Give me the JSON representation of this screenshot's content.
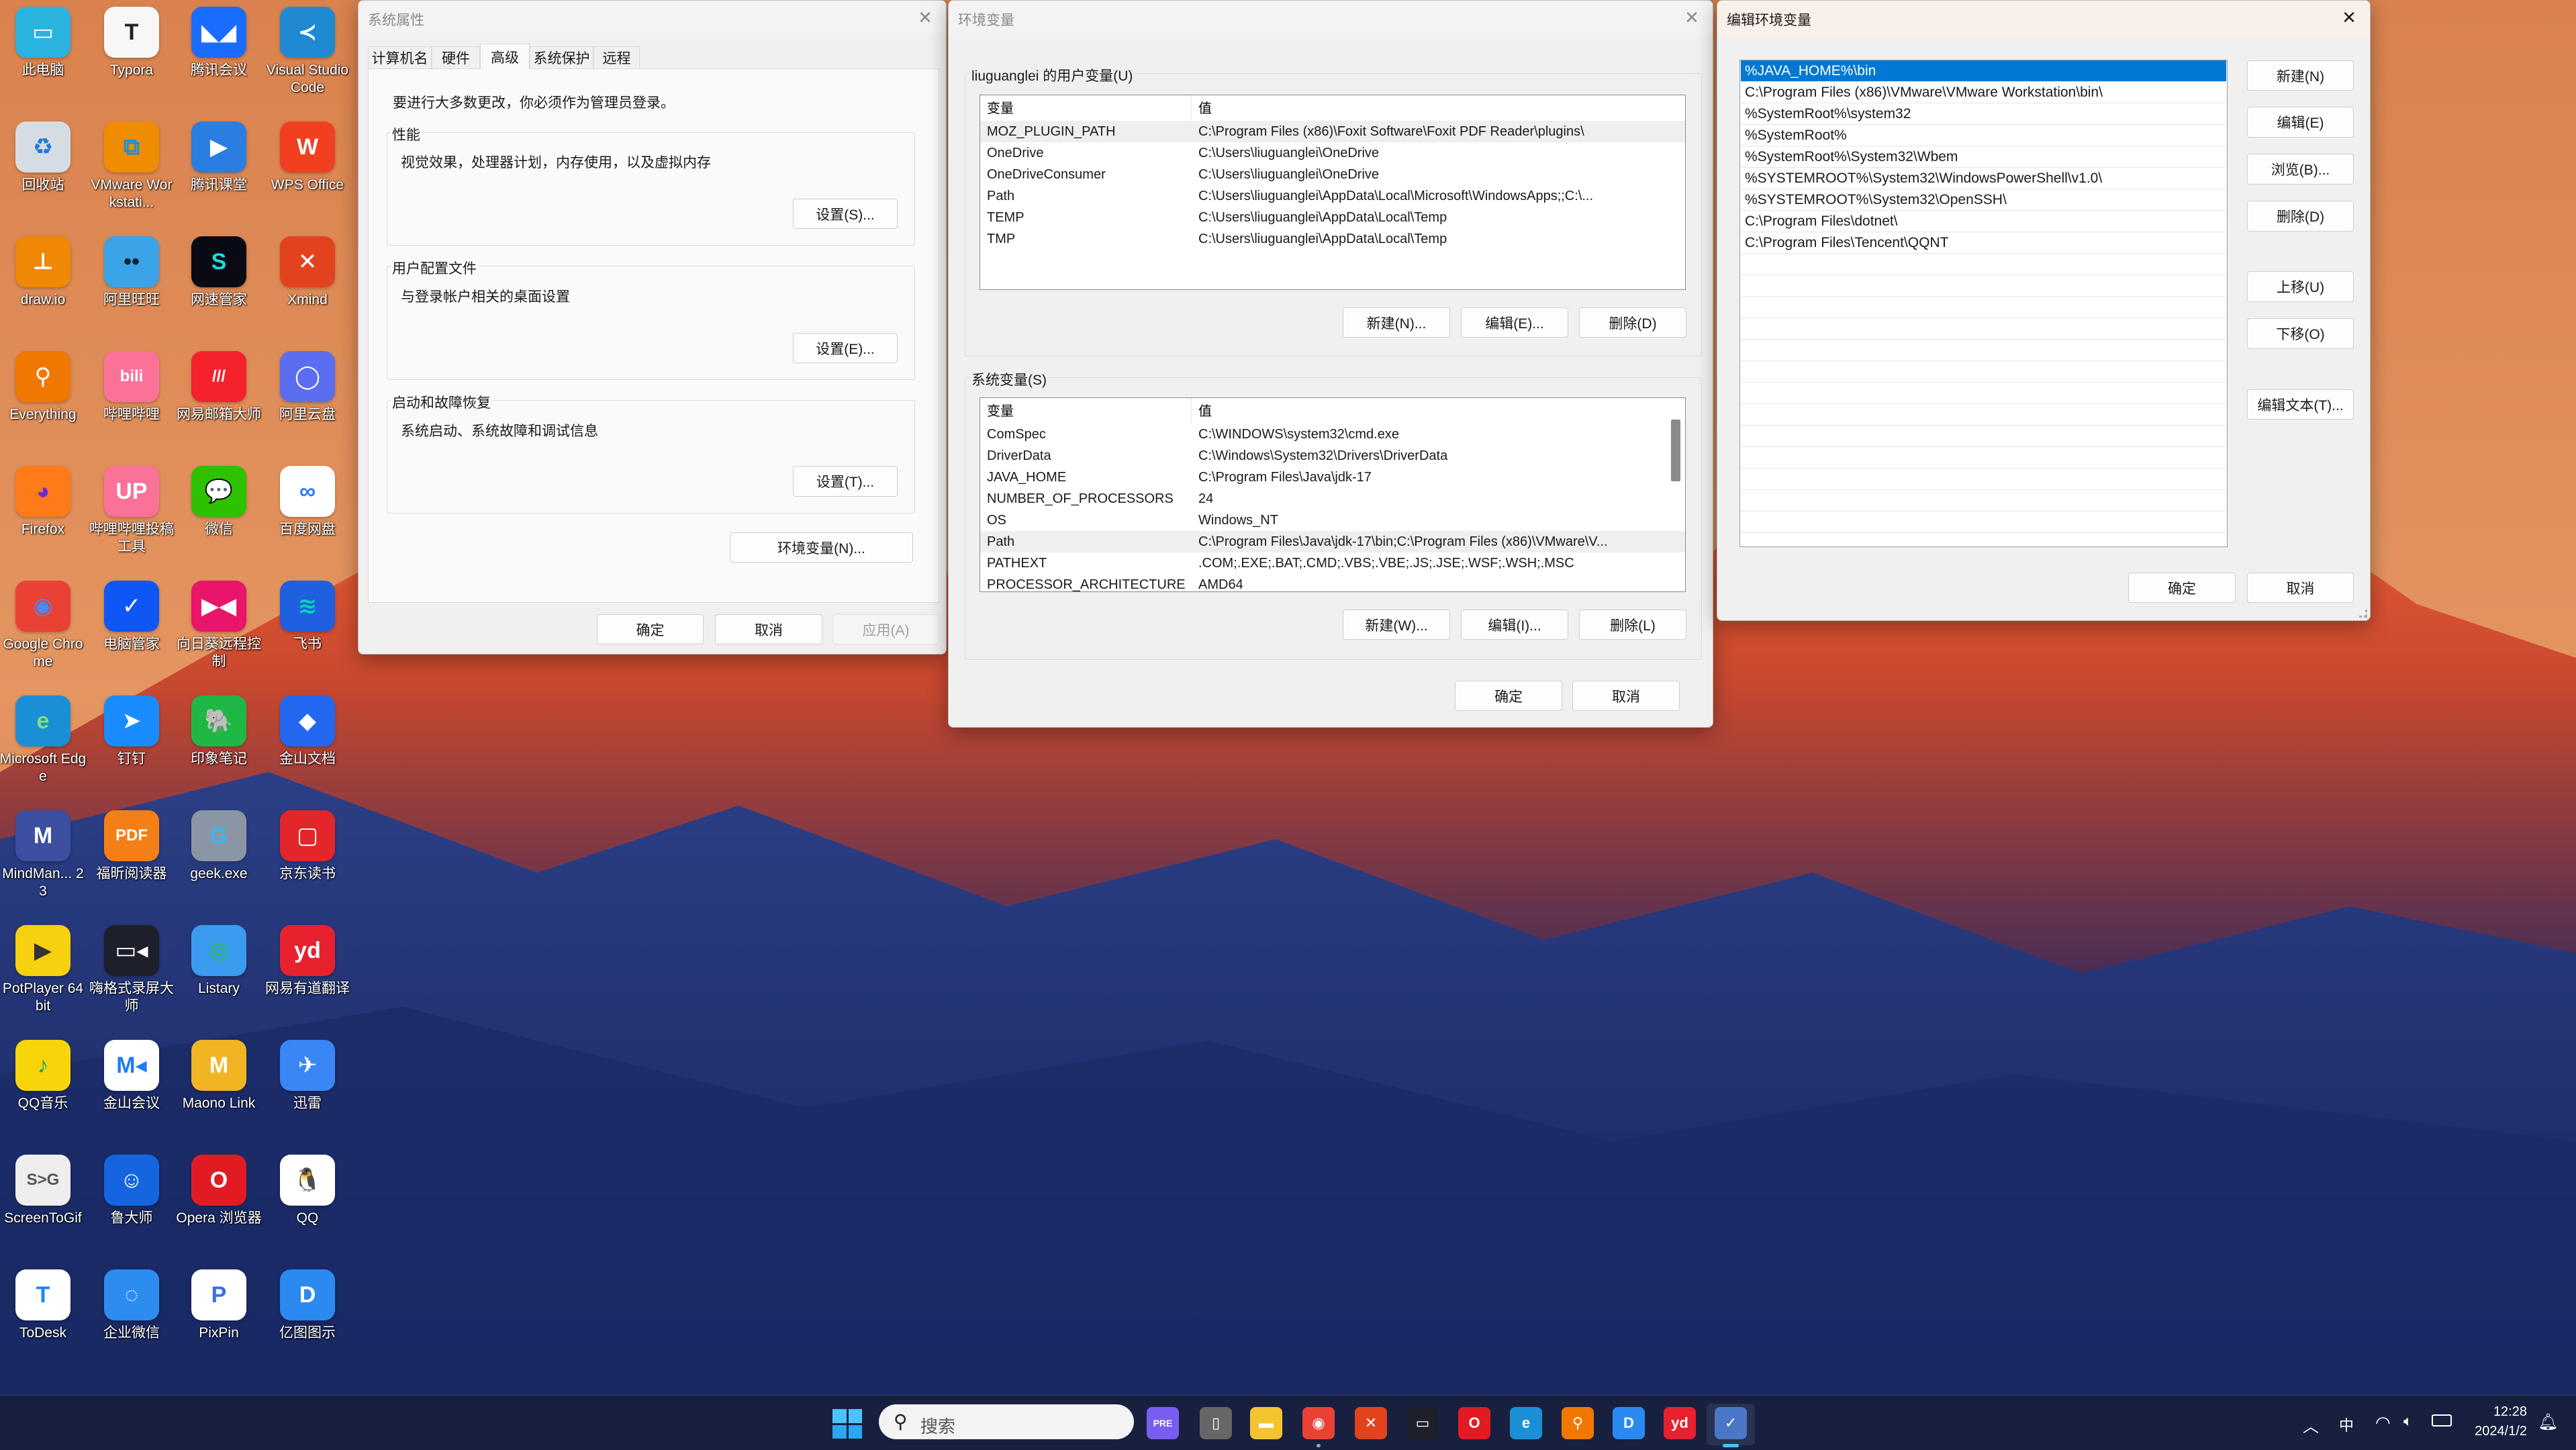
{
  "desktop": {
    "icons": [
      {
        "label": "此电脑",
        "icon": "computer-icon",
        "glyph": "▭",
        "bg": "#2bb3e0",
        "fg": "#fff"
      },
      {
        "label": "Typora",
        "icon": "typora-icon",
        "glyph": "T",
        "bg": "#f7f7f7",
        "fg": "#222"
      },
      {
        "label": "腾讯会议",
        "icon": "tencent-meeting-icon",
        "glyph": "◣◢",
        "bg": "#1a6cff",
        "fg": "#fff"
      },
      {
        "label": "Visual Studio Code",
        "icon": "vscode-icon",
        "glyph": "≺",
        "bg": "#1f8ad2",
        "fg": "#fff"
      },
      {
        "label": "回收站",
        "icon": "recycle-bin-icon",
        "glyph": "♻",
        "bg": "#d5dce2",
        "fg": "#1e7ad8"
      },
      {
        "label": "VMware Workstati...",
        "icon": "vmware-icon",
        "glyph": "⧉",
        "bg": "#f08c00",
        "fg": "#1d8fd6"
      },
      {
        "label": "腾讯课堂",
        "icon": "tencent-classroom-icon",
        "glyph": "▶",
        "bg": "#2a7de1",
        "fg": "#fff"
      },
      {
        "label": "WPS Office",
        "icon": "wps-icon",
        "glyph": "W",
        "bg": "#f0401f",
        "fg": "#fff"
      },
      {
        "label": "draw.io",
        "icon": "drawio-icon",
        "glyph": "⊥",
        "bg": "#f08705",
        "fg": "#fff"
      },
      {
        "label": "阿里旺旺",
        "icon": "aliwangwang-icon",
        "glyph": "••",
        "bg": "#3ba3e8",
        "fg": "#123"
      },
      {
        "label": "网速管家",
        "icon": "netspeed-icon",
        "glyph": "S",
        "bg": "#0a0a14",
        "fg": "#20d8d8"
      },
      {
        "label": "Xmind",
        "icon": "xmind-icon",
        "glyph": "✕",
        "bg": "#e3421f",
        "fg": "#fff"
      },
      {
        "label": "Everything",
        "icon": "everything-icon",
        "glyph": "⚲",
        "bg": "#f07800",
        "fg": "#fff"
      },
      {
        "label": "哔哩哔哩",
        "icon": "bilibili-icon",
        "glyph": "bili",
        "bg": "#fb7299",
        "fg": "#fff"
      },
      {
        "label": "网易邮箱大师",
        "icon": "netease-mail-icon",
        "glyph": "///",
        "bg": "#f5222d",
        "fg": "#fff"
      },
      {
        "label": "阿里云盘",
        "icon": "aliyun-drive-icon",
        "glyph": "◯",
        "bg": "#5b6ef0",
        "fg": "#fff"
      },
      {
        "label": "Firefox",
        "icon": "firefox-icon",
        "glyph": "◕",
        "bg": "#ff7a18",
        "fg": "#6b2bd6"
      },
      {
        "label": "哔哩哔哩投稿工具",
        "icon": "bilibili-upload-icon",
        "glyph": "UP",
        "bg": "#fb7299",
        "fg": "#fff"
      },
      {
        "label": "微信",
        "icon": "wechat-icon",
        "glyph": "💬",
        "bg": "#2dc100",
        "fg": "#fff"
      },
      {
        "label": "百度网盘",
        "icon": "baidu-netdisk-icon",
        "glyph": "∞",
        "bg": "#ffffff",
        "fg": "#2f7cf6"
      },
      {
        "label": "Google Chrome",
        "icon": "chrome-icon",
        "glyph": "◉",
        "bg": "#e94235",
        "fg": "#4a8af4"
      },
      {
        "label": "电脑管家",
        "icon": "pc-manager-icon",
        "glyph": "✓",
        "bg": "#0f57f5",
        "fg": "#fff"
      },
      {
        "label": "向日葵远程控制",
        "icon": "sunlogin-icon",
        "glyph": "▶◀",
        "bg": "#e8156b",
        "fg": "#fff"
      },
      {
        "label": "飞书",
        "icon": "feishu-icon",
        "glyph": "≋",
        "bg": "#1f5fe0",
        "fg": "#00d6b4"
      },
      {
        "label": "Microsoft Edge",
        "icon": "edge-icon",
        "glyph": "e",
        "bg": "#1b8fd6",
        "fg": "#7fe07a"
      },
      {
        "label": "钉钉",
        "icon": "dingtalk-icon",
        "glyph": "➤",
        "bg": "#1a8cff",
        "fg": "#fff"
      },
      {
        "label": "印象笔记",
        "icon": "evernote-icon",
        "glyph": "🐘",
        "bg": "#20b845",
        "fg": "#222"
      },
      {
        "label": "金山文档",
        "icon": "kdocs-icon",
        "glyph": "◆",
        "bg": "#2468f2",
        "fg": "#fff"
      },
      {
        "label": "MindMan... 23",
        "icon": "mindmanager-icon",
        "glyph": "M",
        "bg": "#3d4fa0",
        "fg": "#fff"
      },
      {
        "label": "福昕阅读器",
        "icon": "foxit-icon",
        "glyph": "PDF",
        "bg": "#f57f17",
        "fg": "#fff"
      },
      {
        "label": "geek.exe",
        "icon": "geek-uninstaller-icon",
        "glyph": "G",
        "bg": "#8a96a3",
        "fg": "#3ab5f0"
      },
      {
        "label": "京东读书",
        "icon": "jd-read-icon",
        "glyph": "▢",
        "bg": "#e3262a",
        "fg": "#fff"
      },
      {
        "label": "PotPlayer 64 bit",
        "icon": "potplayer-icon",
        "glyph": "▶",
        "bg": "#f7d00f",
        "fg": "#333"
      },
      {
        "label": "嗨格式录屏大师",
        "icon": "screen-recorder-icon",
        "glyph": "▭◂",
        "bg": "#1d1f2b",
        "fg": "#fff"
      },
      {
        "label": "Listary",
        "icon": "listary-icon",
        "glyph": "◎",
        "bg": "#3a9bef",
        "fg": "#2ec04b"
      },
      {
        "label": "网易有道翻译",
        "icon": "youdao-icon",
        "glyph": "yd",
        "bg": "#e8212e",
        "fg": "#fff"
      },
      {
        "label": "QQ音乐",
        "icon": "qq-music-icon",
        "glyph": "♪",
        "bg": "#f8d50a",
        "fg": "#1fa463"
      },
      {
        "label": "金山会议",
        "icon": "kingsoft-meeting-icon",
        "glyph": "M◂",
        "bg": "#ffffff",
        "fg": "#1e7df0"
      },
      {
        "label": "Maono Link",
        "icon": "maono-link-icon",
        "glyph": "M",
        "bg": "#f1b523",
        "fg": "#fff"
      },
      {
        "label": "迅雷",
        "icon": "thunder-icon",
        "glyph": "✈",
        "bg": "#3a86f5",
        "fg": "#fff"
      },
      {
        "label": "ScreenToGif",
        "icon": "screentogif-icon",
        "glyph": "S>G",
        "bg": "#eeeeee",
        "fg": "#555"
      },
      {
        "label": "鲁大师",
        "icon": "ludashi-icon",
        "glyph": "☺",
        "bg": "#1565e0",
        "fg": "#fff"
      },
      {
        "label": "Opera 浏览器",
        "icon": "opera-icon",
        "glyph": "O",
        "bg": "#e21b23",
        "fg": "#fff"
      },
      {
        "label": "QQ",
        "icon": "qq-icon",
        "glyph": "🐧",
        "bg": "#ffffff",
        "fg": "#000"
      },
      {
        "label": "ToDesk",
        "icon": "todesk-icon",
        "glyph": "T",
        "bg": "#ffffff",
        "fg": "#1e88f5"
      },
      {
        "label": "企业微信",
        "icon": "wecom-icon",
        "glyph": "◌",
        "bg": "#2d8cf0",
        "fg": "#fff"
      },
      {
        "label": "PixPin",
        "icon": "pixpin-icon",
        "glyph": "P",
        "bg": "#ffffff",
        "fg": "#3c6df0"
      },
      {
        "label": "亿图图示",
        "icon": "edraw-icon",
        "glyph": "D",
        "bg": "#2a8af0",
        "fg": "#fff"
      }
    ]
  },
  "sysprops": {
    "title": "系统属性",
    "tabs": [
      "计算机名",
      "硬件",
      "高级",
      "系统保护",
      "远程"
    ],
    "selected_tab": "高级",
    "admin_note": "要进行大多数更改，你必须作为管理员登录。",
    "groups": [
      {
        "label": "性能",
        "desc": "视觉效果，处理器计划，内存使用，以及虚拟内存",
        "button": "设置(S)..."
      },
      {
        "label": "用户配置文件",
        "desc": "与登录帐户相关的桌面设置",
        "button": "设置(E)..."
      },
      {
        "label": "启动和故障恢复",
        "desc": "系统启动、系统故障和调试信息",
        "button": "设置(T)..."
      }
    ],
    "env_button": "环境变量(N)...",
    "ok": "确定",
    "cancel": "取消",
    "apply": "应用(A)"
  },
  "envvars": {
    "title": "环境变量",
    "user_label": "liuguanglei 的用户变量(U)",
    "col_var": "变量",
    "col_val": "值",
    "user_vars": [
      {
        "name": "MOZ_PLUGIN_PATH",
        "value": "C:\\Program Files (x86)\\Foxit Software\\Foxit PDF Reader\\plugins\\",
        "highlight": true
      },
      {
        "name": "OneDrive",
        "value": "C:\\Users\\liuguanglei\\OneDrive"
      },
      {
        "name": "OneDriveConsumer",
        "value": "C:\\Users\\liuguanglei\\OneDrive"
      },
      {
        "name": "Path",
        "value": "C:\\Users\\liuguanglei\\AppData\\Local\\Microsoft\\WindowsApps;;C:\\..."
      },
      {
        "name": "TEMP",
        "value": "C:\\Users\\liuguanglei\\AppData\\Local\\Temp"
      },
      {
        "name": "TMP",
        "value": "C:\\Users\\liuguanglei\\AppData\\Local\\Temp"
      }
    ],
    "user_buttons": [
      "新建(N)...",
      "编辑(E)...",
      "删除(D)"
    ],
    "system_label": "系统变量(S)",
    "system_vars": [
      {
        "name": "ComSpec",
        "value": "C:\\WINDOWS\\system32\\cmd.exe"
      },
      {
        "name": "DriverData",
        "value": "C:\\Windows\\System32\\Drivers\\DriverData"
      },
      {
        "name": "JAVA_HOME",
        "value": "C:\\Program Files\\Java\\jdk-17"
      },
      {
        "name": "NUMBER_OF_PROCESSORS",
        "value": "24"
      },
      {
        "name": "OS",
        "value": "Windows_NT"
      },
      {
        "name": "Path",
        "value": "C:\\Program Files\\Java\\jdk-17\\bin;C:\\Program Files (x86)\\VMware\\V...",
        "highlight": true
      },
      {
        "name": "PATHEXT",
        "value": ".COM;.EXE;.BAT;.CMD;.VBS;.VBE;.JS;.JSE;.WSF;.WSH;.MSC"
      },
      {
        "name": "PROCESSOR_ARCHITECTURE",
        "value": "AMD64"
      }
    ],
    "system_buttons": [
      "新建(W)...",
      "编辑(I)...",
      "删除(L)"
    ],
    "ok": "确定",
    "cancel": "取消"
  },
  "editenv": {
    "title": "编辑环境变量",
    "entries": [
      "%JAVA_HOME%\\bin",
      "C:\\Program Files (x86)\\VMware\\VMware Workstation\\bin\\",
      "%SystemRoot%\\system32",
      "%SystemRoot%",
      "%SystemRoot%\\System32\\Wbem",
      "%SYSTEMROOT%\\System32\\WindowsPowerShell\\v1.0\\",
      "%SYSTEMROOT%\\System32\\OpenSSH\\",
      "C:\\Program Files\\dotnet\\",
      "C:\\Program Files\\Tencent\\QQNT"
    ],
    "selected_index": 0,
    "buttons": {
      "new": "新建(N)",
      "edit": "编辑(E)",
      "browse": "浏览(B)...",
      "delete": "删除(D)",
      "up": "上移(U)",
      "down": "下移(O)",
      "edit_text": "编辑文本(T)..."
    },
    "ok": "确定",
    "cancel": "取消",
    "selection_color": "#0078d4"
  },
  "taskbar": {
    "search_placeholder": "搜索",
    "apps": [
      {
        "icon": "copilot-icon",
        "glyph": "PRE",
        "bg": "#7b5cf0"
      },
      {
        "icon": "task-view-icon",
        "glyph": "▯",
        "bg": "#666"
      },
      {
        "icon": "file-explorer-icon",
        "glyph": "▬",
        "bg": "#f4c430"
      },
      {
        "icon": "chrome-icon",
        "glyph": "◉",
        "bg": "#e94235",
        "running": true
      },
      {
        "icon": "xmind-icon",
        "glyph": "✕",
        "bg": "#e3421f"
      },
      {
        "icon": "screen-recorder-icon",
        "glyph": "▭",
        "bg": "#1d1f2b"
      },
      {
        "icon": "opera-icon",
        "glyph": "O",
        "bg": "#e21b23"
      },
      {
        "icon": "edge-icon",
        "glyph": "e",
        "bg": "#1b8fd6"
      },
      {
        "icon": "everything-icon",
        "glyph": "⚲",
        "bg": "#f07800"
      },
      {
        "icon": "edraw-icon",
        "glyph": "D",
        "bg": "#2a8af0"
      },
      {
        "icon": "youdao-icon",
        "glyph": "yd",
        "bg": "#e8212e"
      },
      {
        "icon": "system-properties-icon",
        "glyph": "✓",
        "bg": "#4a77c8",
        "active": true
      }
    ],
    "ime": "中",
    "time": "12:28",
    "date": "2024/1/2"
  }
}
